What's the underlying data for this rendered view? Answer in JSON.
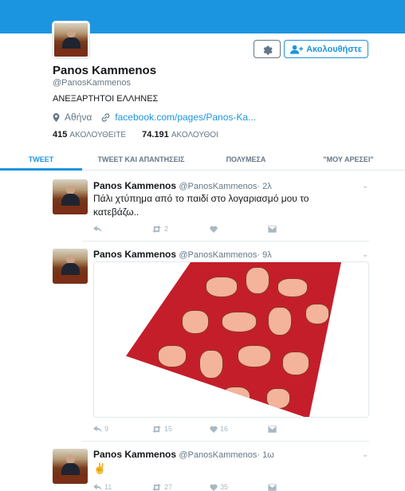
{
  "profile": {
    "name": "Panos Kammenos",
    "handle": "@PanosKammenos",
    "bio": "ΑΝΕΞΑΡΤΗΤΟΙ ΕΛΛΗΝΕΣ",
    "location": "Αθήνα",
    "website": "facebook.com/pages/Panos-Ka...",
    "following_count": "415",
    "following_label": "ΑΚΟΛΟΥΘΕΙΤΕ",
    "followers_count": "74.191",
    "followers_label": "ΑΚΟΛΟΥΘΟΙ",
    "follow_button": "Ακολουθήστε"
  },
  "tabs": [
    "TWEET",
    "TWEET ΚΑΙ ΑΠΑΝΤΗΣΕΙΣ",
    "ΠΟΛΥΜΕΣΑ",
    "\"ΜΟΥ ΑΡΕΣΕΙ\""
  ],
  "tweets": [
    {
      "name": "Panos Kammenos",
      "handle": "@PanosKammenos",
      "time": "· 2λ",
      "text": "Πάλι χτύπημα από το παιδί στο λογαριασμό μου το κατεβάζω..",
      "replies": "",
      "retweets": "2",
      "likes": ""
    },
    {
      "name": "Panos Kammenos",
      "handle": "@PanosKammenos",
      "time": "· 9λ",
      "text": "",
      "replies": "9",
      "retweets": "15",
      "likes": "16"
    },
    {
      "name": "Panos Kammenos",
      "handle": "@PanosKammenos",
      "time": "· 1ω",
      "text": "✌",
      "replies": "11",
      "retweets": "27",
      "likes": "35"
    }
  ],
  "colors": {
    "accent": "#1b95e0",
    "muted": "#657786",
    "header_bar": "#1b95e0"
  }
}
